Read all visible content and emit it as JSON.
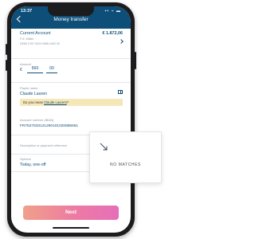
{
  "status_bar": {
    "time": "13:37",
    "icons": "▪▪ ⌁ ▬"
  },
  "header": {
    "title": "Money transfer"
  },
  "account": {
    "label": "Current Account",
    "balance": "€ 1.872,06",
    "holder": "F.G. Müller",
    "iban": "DE65 2157 0024 0988 4492 00"
  },
  "amount": {
    "label": "Amount",
    "currency": "€",
    "euros": "560",
    "cents": "00"
  },
  "payee": {
    "label": "Payee name",
    "value": "Claude Lauren",
    "suggestion_prefix": "Do you mean",
    "suggestion_link": "Claude Laurent",
    "suggestion_suffix": "?"
  },
  "account_number": {
    "label": "Account number (IBAN)",
    "value": "FR7627633121290101020885651"
  },
  "reference": {
    "label": "Description or payment reference"
  },
  "options": {
    "label": "Options",
    "value": "Today, one-off"
  },
  "next_button": {
    "label": "Next"
  },
  "popup": {
    "text": "NO MATCHES"
  },
  "colors": {
    "primary": "#0e4f7a",
    "suggestion_bg": "#f6e7b9",
    "button_gradient_start": "#f0a089",
    "button_gradient_end": "#e56fb9"
  }
}
